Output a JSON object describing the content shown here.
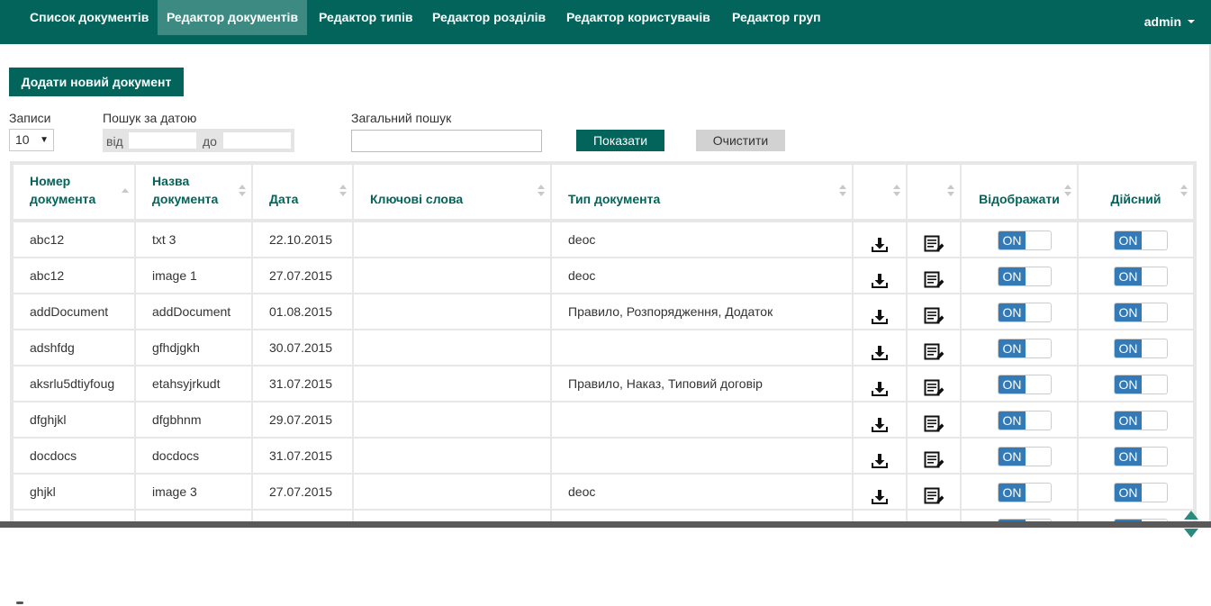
{
  "nav": {
    "items": [
      {
        "label": "Список документів",
        "active": false
      },
      {
        "label": "Редактор документів",
        "active": true
      },
      {
        "label": "Редактор типів",
        "active": false
      },
      {
        "label": "Редактор розділів",
        "active": false
      },
      {
        "label": "Редактор користувачів",
        "active": false
      },
      {
        "label": "Редактор груп",
        "active": false
      }
    ],
    "user": "admin"
  },
  "add_button_label": "Додати новий документ",
  "filters": {
    "records_label": "Записи",
    "records_value": "10",
    "date_label": "Пошук за датою",
    "date_from_label": "від",
    "date_from_value": "",
    "date_to_label": "до",
    "date_to_value": "",
    "search_label": "Загальний пошук",
    "search_value": "",
    "show_label": "Показати",
    "clear_label": "Очистити"
  },
  "table": {
    "columns": [
      {
        "label": "Номер документа",
        "sort": "asc"
      },
      {
        "label": "Назва документа",
        "sort": "both"
      },
      {
        "label": "Дата",
        "sort": "both"
      },
      {
        "label": "Ключові слова",
        "sort": "both"
      },
      {
        "label": "Тип документа",
        "sort": "both"
      },
      {
        "label": "",
        "sort": "both"
      },
      {
        "label": "",
        "sort": "both"
      },
      {
        "label": "Відображати",
        "sort": "both"
      },
      {
        "label": "Дійсний",
        "sort": "both"
      }
    ],
    "toggle_on_label": "ON",
    "rows": [
      {
        "number": "abc12",
        "name": "txt 3",
        "date": "22.10.2015",
        "keywords": "",
        "type": "deoc",
        "display": "ON",
        "valid": "ON"
      },
      {
        "number": "abc12",
        "name": "image 1",
        "date": "27.07.2015",
        "keywords": "",
        "type": "deoc",
        "display": "ON",
        "valid": "ON"
      },
      {
        "number": "addDocument",
        "name": "addDocument",
        "date": "01.08.2015",
        "keywords": "",
        "type": "Правило, Розпорядження, Додаток",
        "display": "ON",
        "valid": "ON"
      },
      {
        "number": "adshfdg",
        "name": "gfhdjgkh",
        "date": "30.07.2015",
        "keywords": "",
        "type": "",
        "display": "ON",
        "valid": "ON"
      },
      {
        "number": "aksrlu5dtiyfoug",
        "name": "etahsyjrkudt",
        "date": "31.07.2015",
        "keywords": "",
        "type": "Правило, Наказ, Типовий договір",
        "display": "ON",
        "valid": "ON"
      },
      {
        "number": "dfghjkl",
        "name": "dfgbhnm",
        "date": "29.07.2015",
        "keywords": "",
        "type": "",
        "display": "ON",
        "valid": "ON"
      },
      {
        "number": "docdocs",
        "name": "docdocs",
        "date": "31.07.2015",
        "keywords": "",
        "type": "",
        "display": "ON",
        "valid": "ON"
      },
      {
        "number": "ghjkl",
        "name": "image 3",
        "date": "27.07.2015",
        "keywords": "",
        "type": "deoc",
        "display": "ON",
        "valid": "ON"
      },
      {
        "number": "",
        "name": "",
        "date": "",
        "keywords": "",
        "type": "",
        "display": "ON",
        "valid": "ON"
      }
    ]
  },
  "colors": {
    "brand": "#02645b",
    "nav_active": "#3d8a82",
    "toggle_on": "#337ab7"
  },
  "icons": {
    "download": "download-icon",
    "edit": "edit-document-icon"
  }
}
